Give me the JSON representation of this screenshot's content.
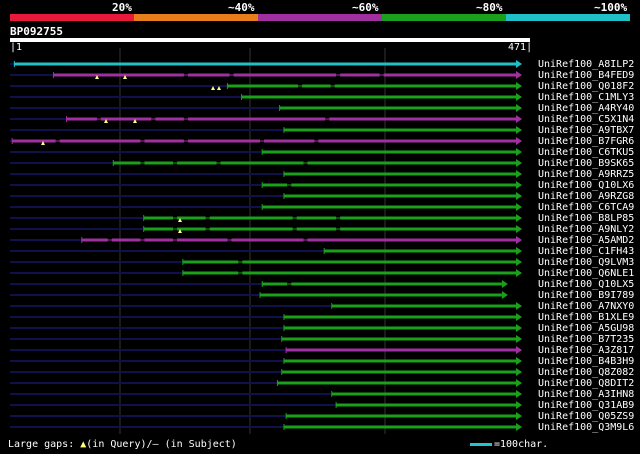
{
  "legend": {
    "labels": [
      "20%",
      "~40%",
      "~60%",
      "~80%",
      "~100%"
    ],
    "colors": [
      "#e8193a",
      "#e87d1e",
      "#a030a0",
      "#1aa01a",
      "#20c0c8"
    ]
  },
  "query": {
    "id": "BP092755",
    "start": "1",
    "end": "471",
    "length": 471
  },
  "hits": [
    {
      "name": "UniRef100_A8ILP2",
      "color": "#20c0c8",
      "start": 4,
      "end": 471,
      "gaps": []
    },
    {
      "name": "UniRef100_B4FED9",
      "color": "#a030a0",
      "start": 40,
      "end": 471,
      "gaps": [
        160,
        202,
        300,
        340
      ]
    },
    {
      "name": "UniRef100_Q018F2",
      "color": "#1aa01a",
      "start": 200,
      "end": 471,
      "gaps": [
        265,
        295
      ]
    },
    {
      "name": "UniRef100_C1MLY3",
      "color": "#1aa01a",
      "start": 213,
      "end": 471,
      "gaps": []
    },
    {
      "name": "UniRef100_A4RY40",
      "color": "#1aa01a",
      "start": 248,
      "end": 471,
      "gaps": []
    },
    {
      "name": "UniRef100_C5X1N4",
      "color": "#a030a0",
      "start": 52,
      "end": 471,
      "gaps": [
        80,
        130,
        160,
        290
      ]
    },
    {
      "name": "UniRef100_A9TBX7",
      "color": "#1aa01a",
      "start": 252,
      "end": 471,
      "gaps": []
    },
    {
      "name": "UniRef100_B7FGR6",
      "color": "#a030a0",
      "start": 2,
      "end": 471,
      "gaps": [
        42,
        120,
        160,
        230,
        280
      ]
    },
    {
      "name": "UniRef100_C6TKU5",
      "color": "#1aa01a",
      "start": 232,
      "end": 471,
      "gaps": []
    },
    {
      "name": "UniRef100_B9SK65",
      "color": "#1aa01a",
      "start": 95,
      "end": 471,
      "gaps": [
        120,
        150,
        190,
        270
      ]
    },
    {
      "name": "UniRef100_A9RRZ5",
      "color": "#1aa01a",
      "start": 252,
      "end": 471,
      "gaps": []
    },
    {
      "name": "UniRef100_Q10LX6",
      "color": "#1aa01a",
      "start": 232,
      "end": 471,
      "gaps": [
        255
      ]
    },
    {
      "name": "UniRef100_A9RZG8",
      "color": "#1aa01a",
      "start": 252,
      "end": 471,
      "gaps": []
    },
    {
      "name": "UniRef100_C6TCA9",
      "color": "#1aa01a",
      "start": 232,
      "end": 471,
      "gaps": []
    },
    {
      "name": "UniRef100_B8LP85",
      "color": "#1aa01a",
      "start": 123,
      "end": 471,
      "gaps": [
        150,
        180,
        260,
        300
      ]
    },
    {
      "name": "UniRef100_A9NLY2",
      "color": "#1aa01a",
      "start": 123,
      "end": 471,
      "gaps": [
        150,
        180,
        260,
        300
      ]
    },
    {
      "name": "UniRef100_A5AMD2",
      "color": "#a030a0",
      "start": 66,
      "end": 471,
      "gaps": [
        90,
        120,
        150,
        200,
        270
      ]
    },
    {
      "name": "UniRef100_C1FH43",
      "color": "#1aa01a",
      "start": 289,
      "end": 471,
      "gaps": []
    },
    {
      "name": "UniRef100_Q9LVM3",
      "color": "#1aa01a",
      "start": 159,
      "end": 471,
      "gaps": [
        210
      ]
    },
    {
      "name": "UniRef100_Q6NLE1",
      "color": "#1aa01a",
      "start": 159,
      "end": 471,
      "gaps": [
        210
      ]
    },
    {
      "name": "UniRef100_Q10LX5",
      "color": "#1aa01a",
      "start": 232,
      "end": 458,
      "gaps": [
        255
      ]
    },
    {
      "name": "UniRef100_B9I789",
      "color": "#1aa01a",
      "start": 230,
      "end": 458,
      "gaps": []
    },
    {
      "name": "UniRef100_A7NXY0",
      "color": "#1aa01a",
      "start": 296,
      "end": 471,
      "gaps": []
    },
    {
      "name": "UniRef100_B1XLE9",
      "color": "#1aa01a",
      "start": 252,
      "end": 471,
      "gaps": []
    },
    {
      "name": "UniRef100_A5GU98",
      "color": "#1aa01a",
      "start": 252,
      "end": 471,
      "gaps": []
    },
    {
      "name": "UniRef100_B7T235",
      "color": "#1aa01a",
      "start": 250,
      "end": 471,
      "gaps": []
    },
    {
      "name": "UniRef100_A3Z817",
      "color": "#a030a0",
      "start": 254,
      "end": 471,
      "gaps": []
    },
    {
      "name": "UniRef100_B4B3H9",
      "color": "#1aa01a",
      "start": 252,
      "end": 471,
      "gaps": []
    },
    {
      "name": "UniRef100_Q8Z082",
      "color": "#1aa01a",
      "start": 250,
      "end": 471,
      "gaps": []
    },
    {
      "name": "UniRef100_Q8DIT2",
      "color": "#1aa01a",
      "start": 246,
      "end": 471,
      "gaps": []
    },
    {
      "name": "UniRef100_A3IHN8",
      "color": "#1aa01a",
      "start": 296,
      "end": 471,
      "gaps": []
    },
    {
      "name": "UniRef100_Q31AB9",
      "color": "#1aa01a",
      "start": 300,
      "end": 471,
      "gaps": []
    },
    {
      "name": "UniRef100_Q05ZS9",
      "color": "#1aa01a",
      "start": 254,
      "end": 471,
      "gaps": []
    },
    {
      "name": "UniRef100_Q3M9L6",
      "color": "#1aa01a",
      "start": 252,
      "end": 471,
      "gaps": []
    }
  ],
  "footer": {
    "gaps_prefix": "Large gaps: ",
    "query_marker": "▲",
    "query_text": "(in Query)/",
    "subject_marker": "—",
    "subject_text": " (in Subject)",
    "scale_text": "=100char."
  }
}
